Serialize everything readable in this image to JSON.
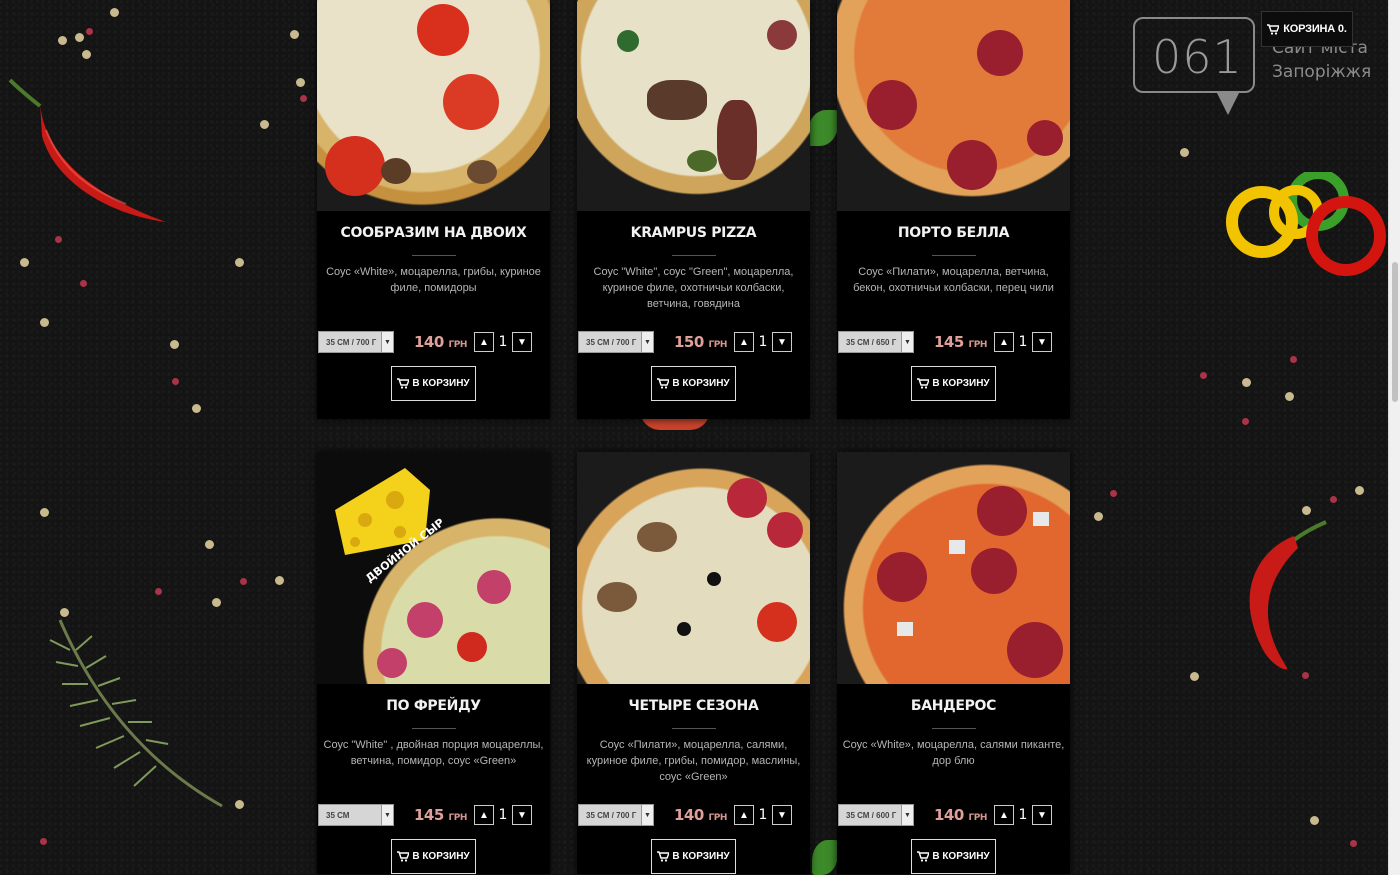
{
  "header": {
    "cart_label": "КОРЗИНА 0.",
    "cart_icon": "cart-icon",
    "logo_number": "061",
    "logo_line1": "Сайт міста",
    "logo_line2": "Запоріжжя"
  },
  "colors": {
    "background": "#141414",
    "card_bg": "#000000",
    "price": "#e0a09a",
    "chili": "#c81a16",
    "pepper_yellow": "#f2c300"
  },
  "products": [
    {
      "name": "СООБРАЗИМ НА ДВОИХ",
      "description": "Соус «White», моцарелла, грибы, куриное филе, помидоры",
      "size": "35 СМ / 700 Г",
      "price": "140",
      "currency": "ГРН",
      "quantity": "1",
      "button": "В КОРЗИНУ"
    },
    {
      "name": "KRAMPUS PIZZA",
      "description": "Соус \"White\", соус \"Green\", моцарелла, куриное филе, охотничьи колбаски, ветчина, говядина",
      "size": "35 СМ / 700 Г",
      "price": "150",
      "currency": "ГРН",
      "quantity": "1",
      "button": "В КОРЗИНУ"
    },
    {
      "name": "ПОРТО БЕЛЛА",
      "description": "Соус «Пилати», моцарелла, ветчина, бекон, охотничьи колбаски, перец чили",
      "size": "35 СМ / 650 Г",
      "price": "145",
      "currency": "ГРН",
      "quantity": "1",
      "button": "В КОРЗИНУ"
    },
    {
      "name": "ПО ФРЕЙДУ",
      "description": "Соус \"White\" , двойная порция моцареллы, ветчина, помидор, соус «Green»",
      "size": "35 СМ",
      "price": "145",
      "currency": "ГРН",
      "quantity": "1",
      "button": "В КОРЗИНУ",
      "badge": "ДВОЙНОЙ СЫР"
    },
    {
      "name": "ЧЕТЫРЕ СЕЗОНА",
      "description": "Соус «Пилати», моцарелла, салями, куриное филе, грибы, помидор, маслины, соус «Green»",
      "size": "35 СМ / 700 Г",
      "price": "140",
      "currency": "ГРН",
      "quantity": "1",
      "button": "В КОРЗИНУ"
    },
    {
      "name": "БАНДЕРОС",
      "description": "Соус «White», моцарелла, салями пиканте, дор блю",
      "size": "35 СМ / 600 Г",
      "price": "140",
      "currency": "ГРН",
      "quantity": "1",
      "button": "В КОРЗИНУ"
    }
  ]
}
